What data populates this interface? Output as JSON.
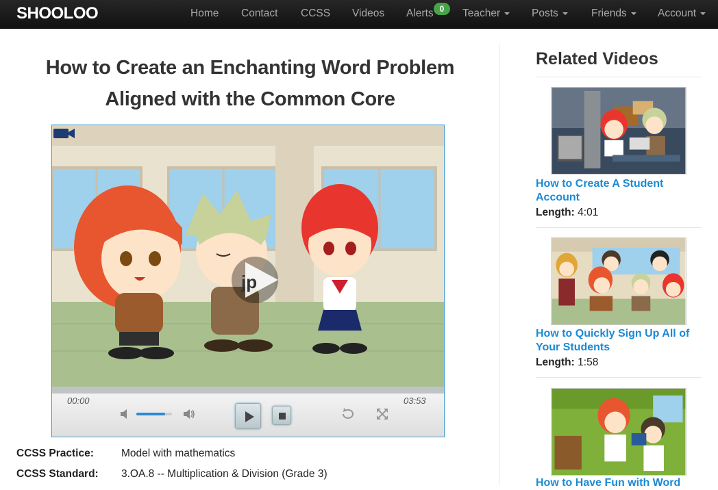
{
  "brand": "SHOOLOO",
  "nav": {
    "home": "Home",
    "contact": "Contact",
    "ccss": "CCSS",
    "videos": "Videos",
    "alerts": "Alerts",
    "alerts_count": "0",
    "teacher": "Teacher",
    "posts": "Posts",
    "friends": "Friends",
    "account": "Account"
  },
  "video": {
    "title_line1": "How to Create an Enchanting Word Problem",
    "title_line2": "Aligned with the Common Core",
    "time_current": "00:00",
    "time_total": "03:53",
    "volume_level": 0.8,
    "watermark": "jp"
  },
  "ccss": {
    "practice_label": "CCSS Practice:",
    "practice_value": "Model with mathematics",
    "standard_label": "CCSS Standard:",
    "standard_value": "3.OA.8 -- Multiplication & Division (Grade 3)"
  },
  "sidebar": {
    "title": "Related Videos",
    "length_label": "Length:",
    "items": [
      {
        "title_line1": "How to Create A Student",
        "title_line2": "Account",
        "length": "4:01"
      },
      {
        "title_line1": "How to Quickly Sign Up All of",
        "title_line2": "Your Students",
        "length": "1:58"
      },
      {
        "title_line1": "How to Have Fun with Word",
        "title_line2": "",
        "length": ""
      }
    ]
  },
  "colors": {
    "navbar": "#1b1b1b",
    "link": "#1a8ad4",
    "badge": "#46a546",
    "player_border": "#3d9ad1"
  }
}
